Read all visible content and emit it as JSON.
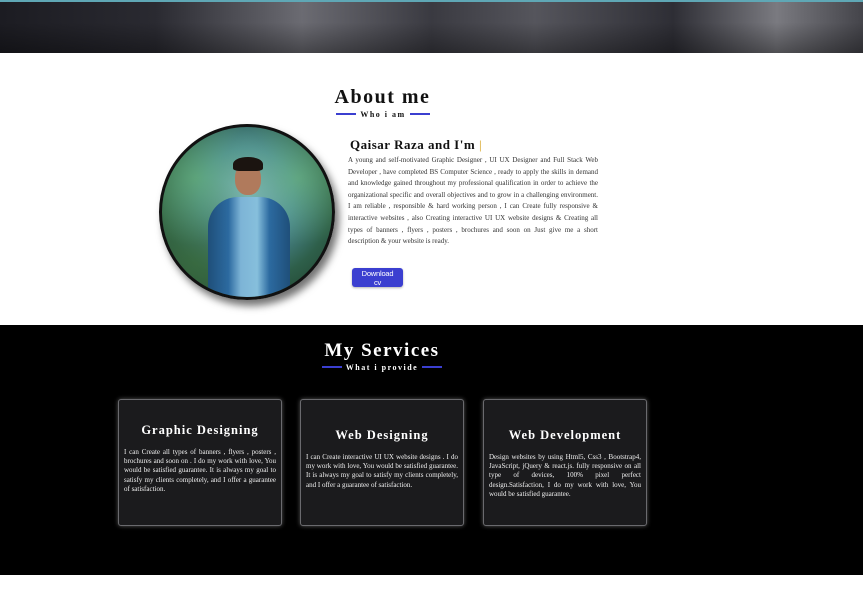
{
  "about": {
    "title": "About me",
    "subtitle": "Who i am",
    "name_line": "Qaisar Raza and I'm",
    "cursor": "|",
    "bio": "A young and self-motivated Graphic Designer , UI UX Designer and Full Stack Web Developer , have completed BS Computer Science , ready to apply the skills in demand and knowledge gained throughout my professional qualification in order to achieve the organizational specific and overall objectives and to grow in a challenging environment. I am reliable , responsible & hard working person , I can Create fully responsive & interactive websites , also Creating interactive UI UX website designs & Creating all types of banners , flyers , posters , brochures and soon on Just give me a short description & your website is ready.",
    "download_label": "Download cv"
  },
  "services": {
    "title": "My Services",
    "subtitle": "What i provide",
    "cards": [
      {
        "title": "Graphic Designing",
        "text": "I can Create all types of banners , flyers , posters , brochures and soon on . I do my work with love, You would be satisfied guarantee. It is always my goal to satisfy my clients completely, and I offer a guarantee of satisfaction."
      },
      {
        "title": "Web Designing",
        "text": "I can Create interactive UI UX website designs . I do my work with love, You would be satisfied guarantee. It is always my goal to satisfy my clients completely, and I offer a guarantee of satisfaction."
      },
      {
        "title": "Web Development",
        "text": "Design websites by using Html5, Css3 , Bootstrap4, JavaScript, jQuery & react.js. fully responsive on all type of devices, 100% pixel perfect design.Satisfaction, I do my work with love, You would be satisfied guarantee."
      }
    ]
  },
  "colors": {
    "accent": "#3b3fd0",
    "services_background": "#000000",
    "card_background": "#1b1b1d",
    "cursor": "#d4a017"
  }
}
